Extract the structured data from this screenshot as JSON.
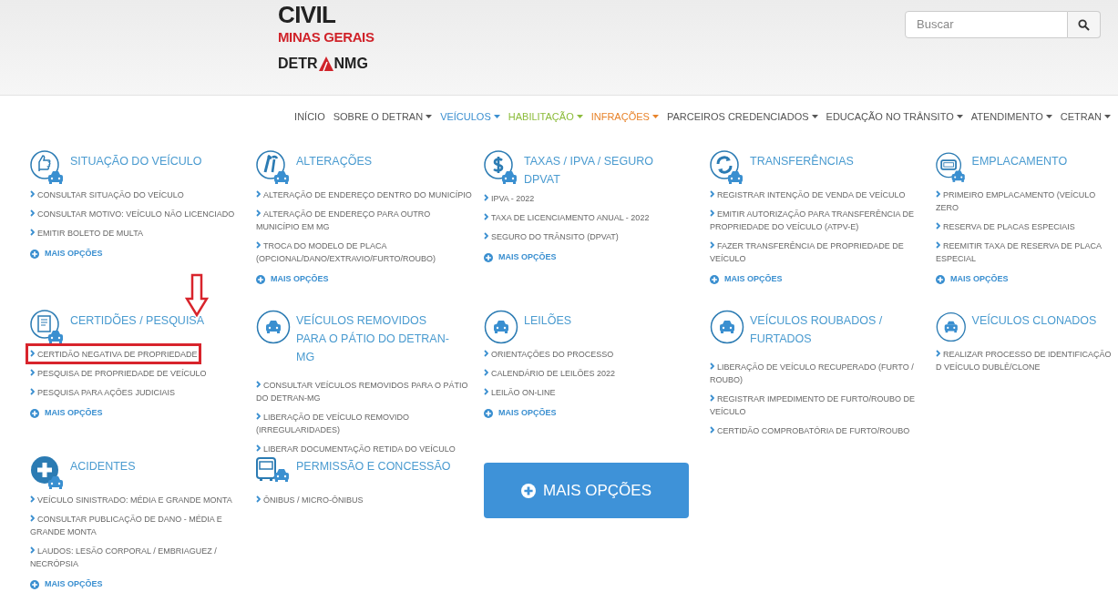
{
  "logo": {
    "line_1": "CIVIL",
    "line_2": "MINAS GERAIS",
    "line_3_left": "DETR",
    "line_3_right": "NMG"
  },
  "search": {
    "placeholder": "Buscar"
  },
  "nav": [
    {
      "label": "INÍCIO",
      "dropdown": false,
      "color": "#555555"
    },
    {
      "label": "SOBRE O DETRAN",
      "dropdown": true,
      "color": "#555555"
    },
    {
      "label": "VEÍCULOS",
      "dropdown": true,
      "color": "#3a8fd0"
    },
    {
      "label": "HABILITAÇÃO",
      "dropdown": true,
      "color": "#8cbc3c"
    },
    {
      "label": "INFRAÇÕES",
      "dropdown": true,
      "color": "#e8832a"
    },
    {
      "label": "PARCEIROS CREDENCIADOS",
      "dropdown": true,
      "color": "#555555"
    },
    {
      "label": "EDUCAÇÃO NO TRÂNSITO",
      "dropdown": true,
      "color": "#555555"
    },
    {
      "label": "ATENDIMENTO",
      "dropdown": true,
      "color": "#555555"
    },
    {
      "label": "CETRAN",
      "dropdown": true,
      "color": "#555555"
    }
  ],
  "rows": [
    [
      {
        "kind": "section",
        "title": "SITUAÇÃO DO VEÍCULO",
        "links": [
          {
            "text": "CONSULTAR SITUAÇÃO DO VEÍCULO",
            "highlighted": false
          },
          {
            "text": "CONSULTAR MOTIVO: VEÍCULO NÃO LICENCIADO",
            "highlighted": false
          },
          {
            "text": "EMITIR BOLETO DE MULTA",
            "highlighted": false
          }
        ],
        "more": "MAIS OPÇÕES"
      },
      {
        "kind": "section",
        "title": "ALTERAÇÕES",
        "links": [
          {
            "text": "ALTERAÇÃO DE ENDEREÇO DENTRO DO MUNICÍPIO",
            "highlighted": false
          },
          {
            "text": "ALTERAÇÃO DE ENDEREÇO PARA OUTRO MUNICÍPIO EM MG",
            "highlighted": false
          },
          {
            "text": "TROCA DO MODELO DE PLACA (OPCIONAL/DANO/EXTRAVIO/FURTO/ROUBO)",
            "highlighted": false
          }
        ],
        "more": "MAIS OPÇÕES"
      },
      {
        "kind": "section",
        "title": "TAXAS / IPVA / SEGURO DPVAT",
        "links": [
          {
            "text": "IPVA - 2022",
            "highlighted": false
          },
          {
            "text": "TAXA DE LICENCIAMENTO ANUAL - 2022",
            "highlighted": false
          },
          {
            "text": "SEGURO DO TRÂNSITO (DPVAT)",
            "highlighted": false
          }
        ],
        "more": "MAIS OPÇÕES"
      },
      {
        "kind": "section",
        "title": "TRANSFERÊNCIAS",
        "links": [
          {
            "text": "REGISTRAR INTENÇÃO DE VENDA DE VEÍCULO",
            "highlighted": false
          },
          {
            "text": "EMITIR AUTORIZAÇÃO PARA TRANSFERÊNCIA DE PROPRIEDADE DO VEÍCULO (ATPV-E)",
            "highlighted": false
          },
          {
            "text": "FAZER TRANSFERÊNCIA DE PROPRIEDADE DE VEÍCULO",
            "highlighted": false
          }
        ],
        "more": "MAIS OPÇÕES"
      },
      {
        "kind": "section",
        "title": "EMPLACAMENTO",
        "links": [
          {
            "text": "PRIMEIRO EMPLACAMENTO (VEÍCULO ZERO",
            "highlighted": false
          },
          {
            "text": "RESERVA DE PLACAS ESPECIAIS",
            "highlighted": false
          },
          {
            "text": "REEMITIR TAXA DE RESERVA DE PLACA ESPECIAL",
            "highlighted": false
          }
        ],
        "more": "MAIS OPÇÕES"
      }
    ],
    [
      {
        "kind": "section",
        "title": "CERTIDÕES / PESQUISA",
        "links": [
          {
            "text": "CERTIDÃO NEGATIVA DE PROPRIEDADE",
            "highlighted": true
          },
          {
            "text": "PESQUISA DE PROPRIEDADE DE VEÍCULO",
            "highlighted": false
          },
          {
            "text": "PESQUISA PARA AÇÕES JUDICIAIS",
            "highlighted": false
          }
        ],
        "more": "MAIS OPÇÕES"
      },
      {
        "kind": "section",
        "title": "VEÍCULOS REMOVIDOS PARA O PÁTIO DO DETRAN-MG",
        "links": [
          {
            "text": "CONSULTAR VEÍCULOS REMOVIDOS PARA O PÁTIO DO DETRAN-MG",
            "highlighted": false
          },
          {
            "text": "LIBERAÇÃO DE VEÍCULO REMOVIDO (IRREGULARIDADES)",
            "highlighted": false
          },
          {
            "text": "LIBERAR DOCUMENTAÇÃO RETIDA DO VEÍCULO",
            "highlighted": false
          }
        ]
      },
      {
        "kind": "section",
        "title": "LEILÕES",
        "links": [
          {
            "text": "ORIENTAÇÕES DO PROCESSO",
            "highlighted": false
          },
          {
            "text": "CALENDÁRIO DE LEILÕES 2022",
            "highlighted": false
          },
          {
            "text": "LEILÃO ON-LINE",
            "highlighted": false
          }
        ],
        "more": "MAIS OPÇÕES"
      },
      {
        "kind": "section",
        "title": "VEÍCULOS ROUBADOS / FURTADOS",
        "links": [
          {
            "text": "LIBERAÇÃO DE VEÍCULO RECUPERADO (FURTO / ROUBO)",
            "highlighted": false
          },
          {
            "text": "REGISTRAR IMPEDIMENTO DE FURTO/ROUBO DE VEÍCULO",
            "highlighted": false
          },
          {
            "text": "CERTIDÃO COMPROBATÓRIA DE FURTO/ROUBO",
            "highlighted": false
          }
        ]
      },
      {
        "kind": "section",
        "title": "VEÍCULOS CLONADOS",
        "links": [
          {
            "text": "REALIZAR PROCESSO DE IDENTIFICAÇÃO D VEÍCULO DUBLÊ/CLONE",
            "highlighted": false
          }
        ]
      }
    ],
    [
      {
        "kind": "section",
        "title": "ACIDENTES",
        "links": [
          {
            "text": "VEÍCULO SINISTRADO: MÉDIA E GRANDE MONTA",
            "highlighted": false
          },
          {
            "text": "CONSULTAR PUBLICAÇÃO DE DANO - MÉDIA E GRANDE MONTA",
            "highlighted": false
          },
          {
            "text": "LAUDOS: LESÃO CORPORAL / EMBRIAGUEZ / NECRÓPSIA",
            "highlighted": false
          }
        ],
        "more": "MAIS OPÇÕES"
      },
      {
        "kind": "section",
        "title": "PERMISSÃO E CONCESSÃO",
        "links": [
          {
            "text": "ÔNIBUS / MICRO-ÔNIBUS",
            "highlighted": false
          }
        ]
      },
      {
        "kind": "button",
        "label": "MAIS OPÇÕES"
      }
    ]
  ]
}
